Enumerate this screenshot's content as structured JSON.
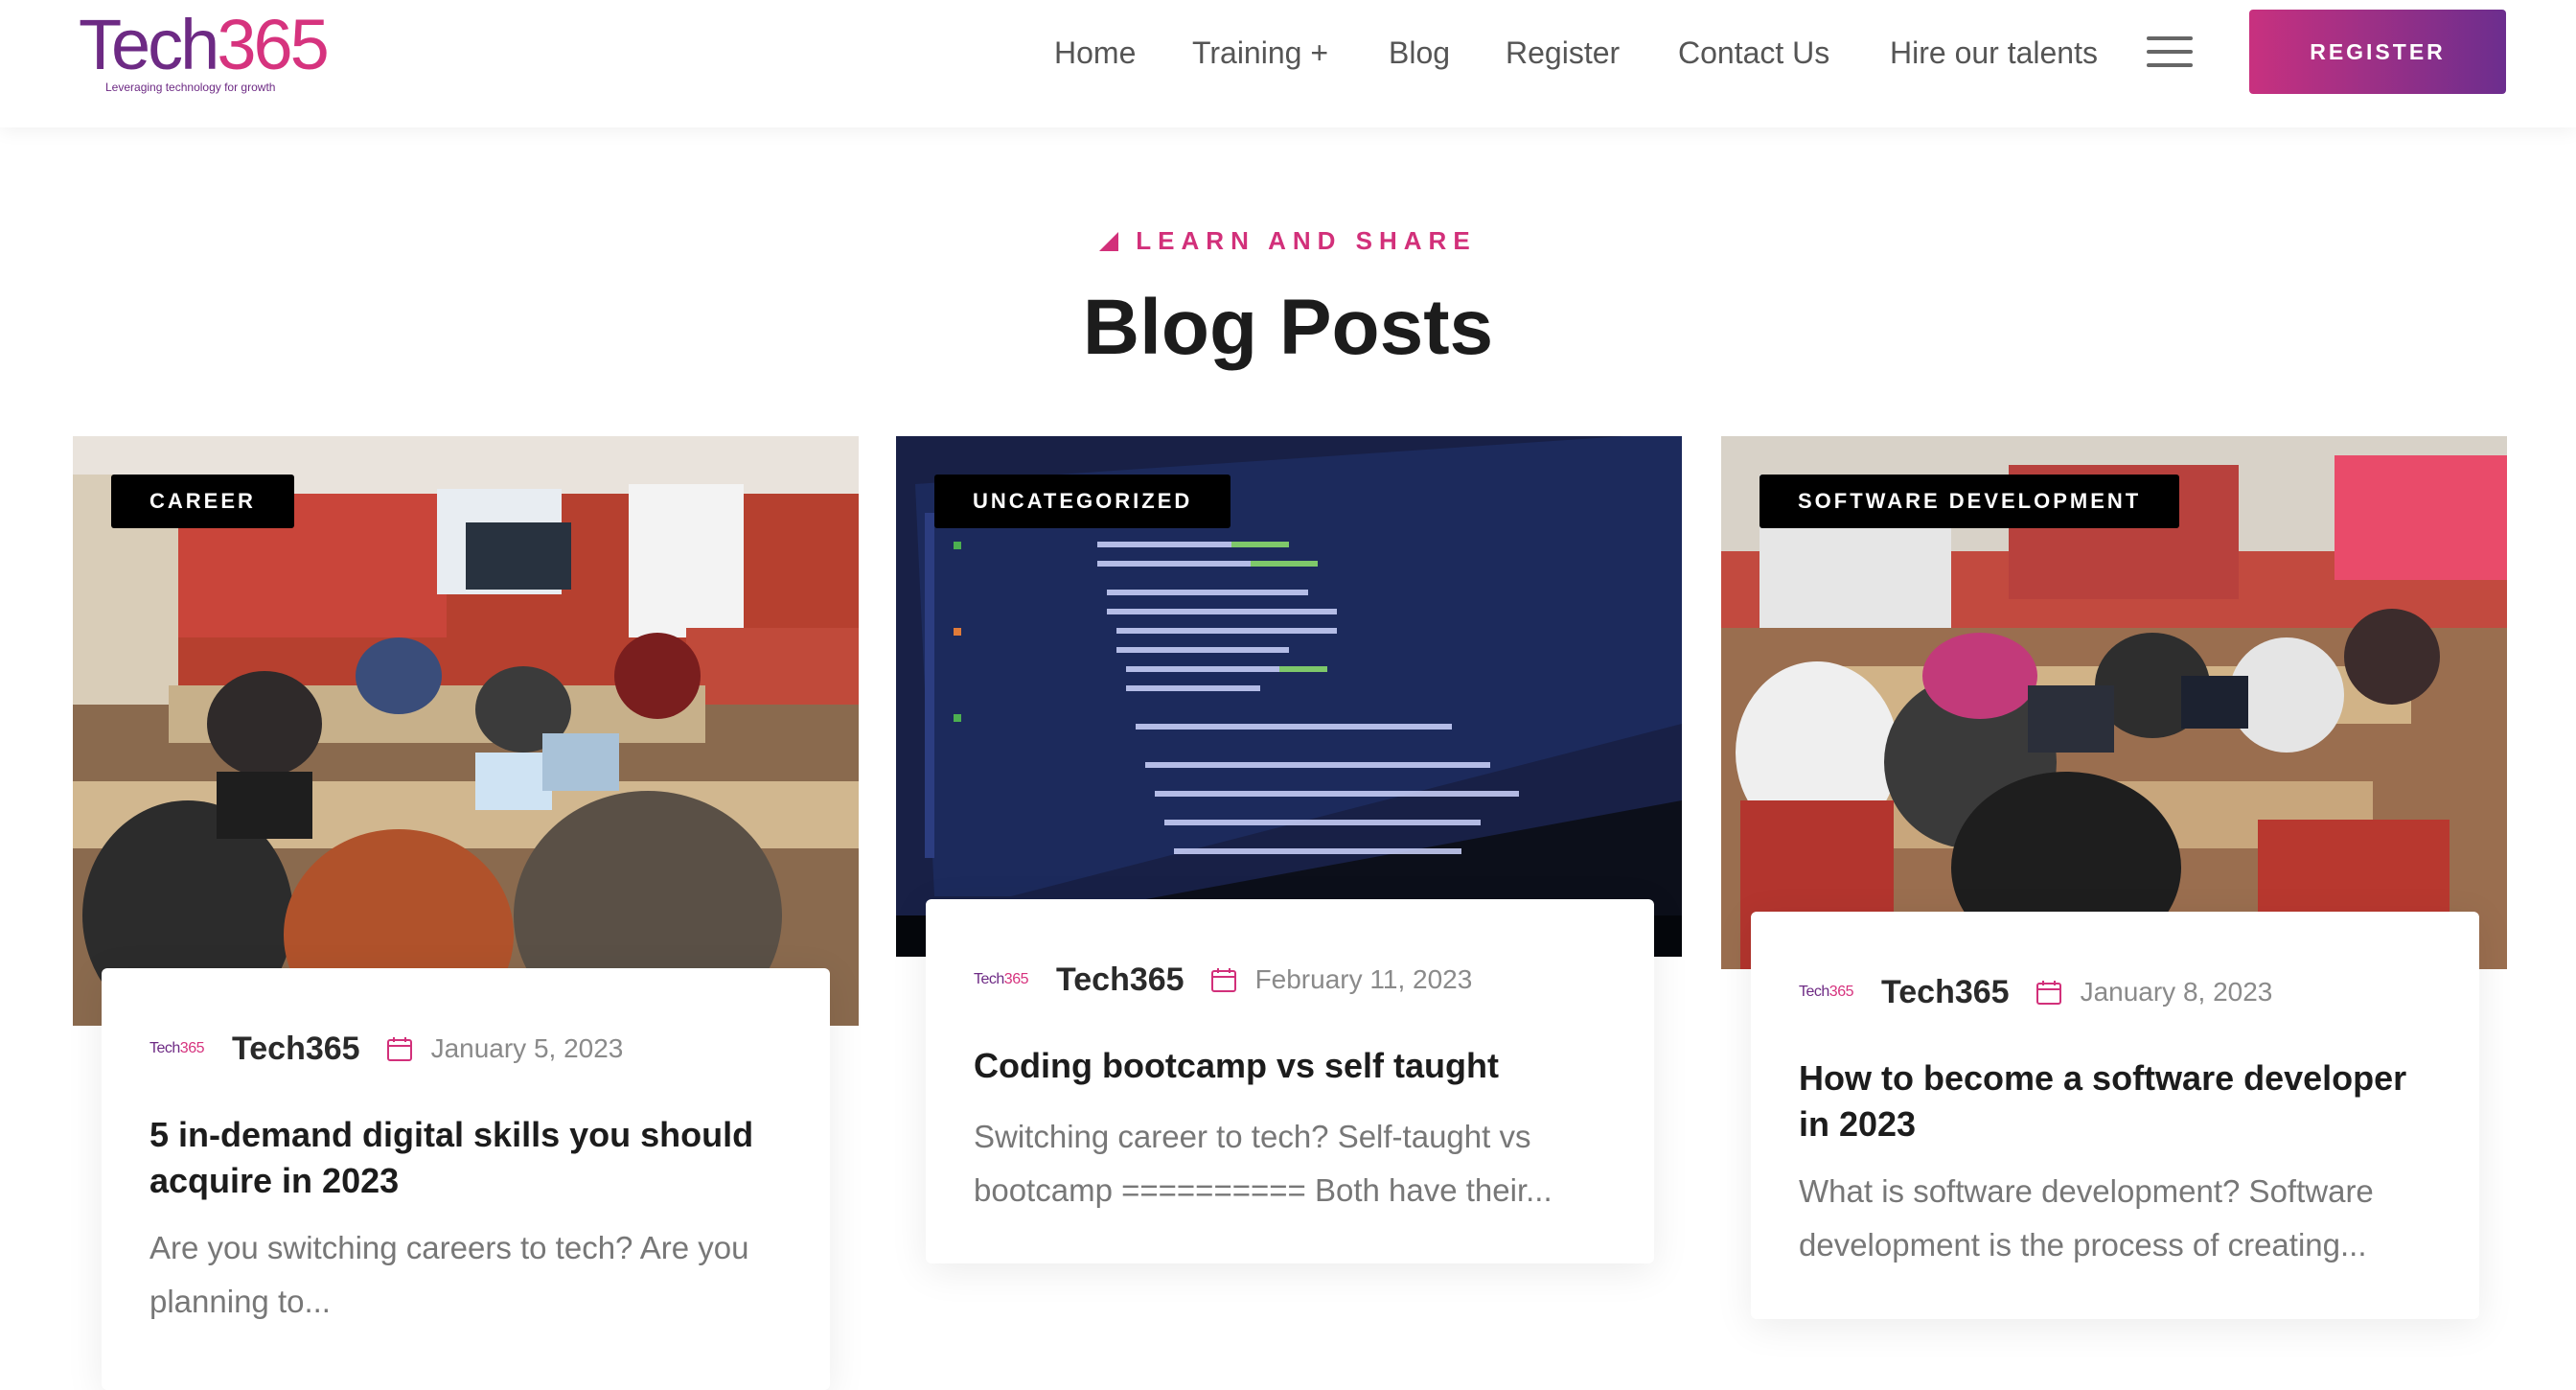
{
  "header": {
    "logo": {
      "word_main": "Tech",
      "word_accent": "365",
      "tagline": "Leveraging technology for growth"
    },
    "nav": [
      "Home",
      "Training +",
      "Blog",
      "Register",
      "Contact Us",
      "Hire our talents"
    ],
    "menu_icon": "hamburger-menu-icon",
    "register_button": "REGISTER"
  },
  "section": {
    "eyebrow": "LEARN AND SHARE",
    "heading": "Blog Posts"
  },
  "colors": {
    "accent": "#d2307a",
    "brand_purple": "#6d2a84",
    "button_gradient_start": "#c8317f",
    "button_gradient_end": "#6c2e8e"
  },
  "posts": [
    {
      "category": "CAREER",
      "author_logo": {
        "main": "Tech",
        "accent": "365"
      },
      "author": "Tech365",
      "date": "January 5, 2023",
      "title": "5 in-demand digital skills you should acquire in 2023",
      "excerpt": "Are you switching careers to tech? Are you planning to..."
    },
    {
      "category": "UNCATEGORIZED",
      "author_logo": {
        "main": "Tech",
        "accent": "365"
      },
      "author": "Tech365",
      "date": "February 11, 2023",
      "title": "Coding bootcamp vs self taught",
      "excerpt": "Switching career to tech? Self-taught vs bootcamp ========== Both have their..."
    },
    {
      "category": "SOFTWARE DEVELOPMENT",
      "author_logo": {
        "main": "Tech",
        "accent": "365"
      },
      "author": "Tech365",
      "date": "January 8, 2023",
      "title": "How to become a software developer in 2023",
      "excerpt": "What is software development? Software development is the process of creating..."
    }
  ]
}
